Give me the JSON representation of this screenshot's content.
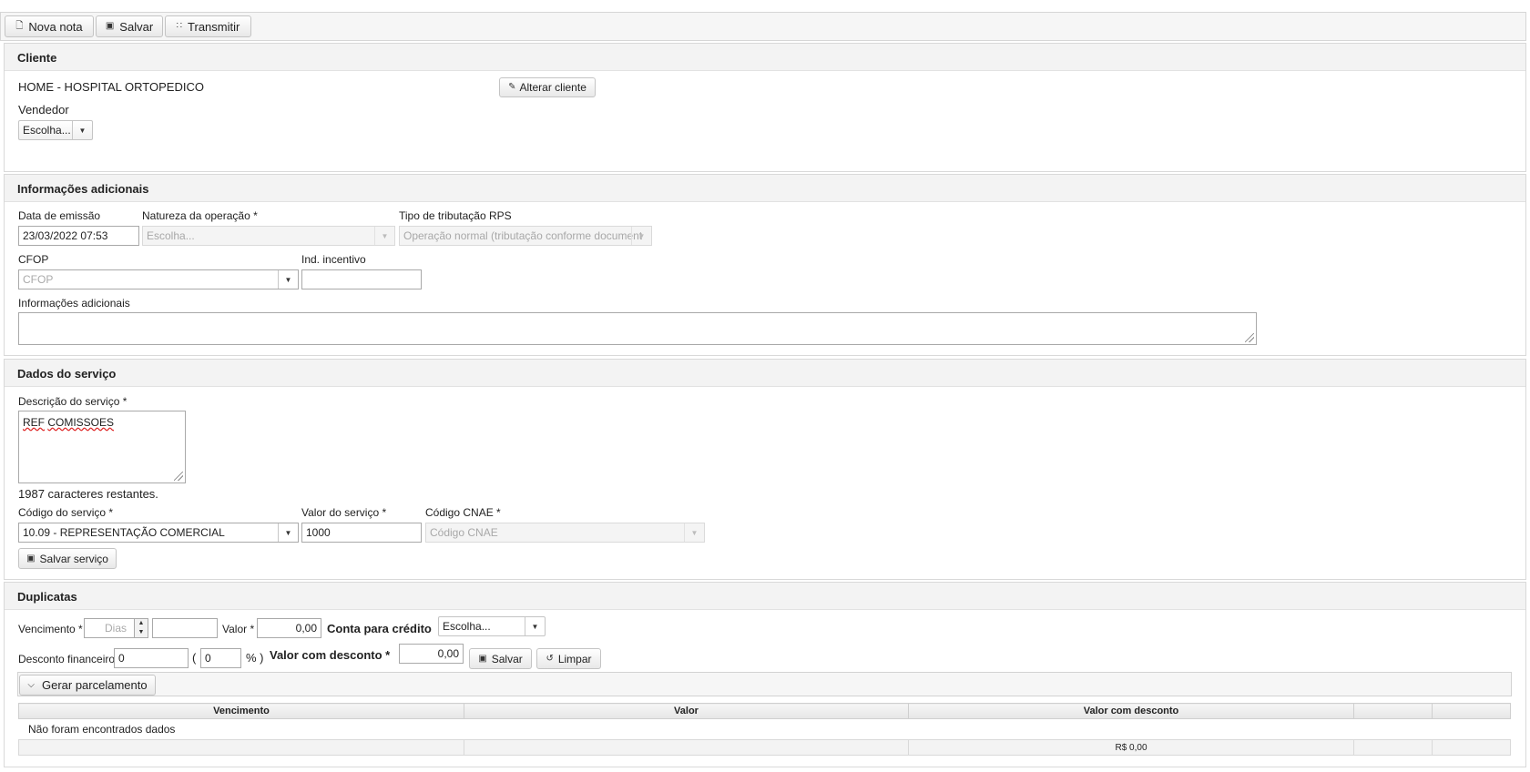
{
  "toolbar": {
    "new_label": "Nova nota",
    "save_label": "Salvar",
    "transmit_label": "Transmitir"
  },
  "cliente": {
    "title": "Cliente",
    "name": "HOME - HOSPITAL ORTOPEDICO",
    "change_button": "Alterar cliente",
    "vendedor_label": "Vendedor",
    "vendedor_value": "Escolha..."
  },
  "info": {
    "title": "Informações adicionais",
    "data_emissao_label": "Data de emissão",
    "data_emissao_value": "23/03/2022 07:53",
    "natureza_label": "Natureza da operação *",
    "natureza_placeholder": "Escolha...",
    "tributacao_label": "Tipo de tributação RPS",
    "tributacao_value": "Operação normal (tributação conforme document",
    "cfop_label": "CFOP",
    "cfop_placeholder": "CFOP",
    "ind_incentivo_label": "Ind. incentivo",
    "ind_incentivo_value": "",
    "info_label": "Informações adicionais",
    "info_value": ""
  },
  "servico": {
    "title": "Dados do serviço",
    "descricao_label": "Descrição do serviço *",
    "descricao_value_a": "REF",
    "descricao_value_b": "COMISSOES",
    "remaining": "1987 caracteres restantes.",
    "codigo_label": "Código do serviço *",
    "codigo_value": "10.09 - REPRESENTAÇÃO COMERCIAL",
    "valor_label": "Valor do serviço *",
    "valor_value": "1000",
    "cnae_label": "Código CNAE *",
    "cnae_placeholder": "Código CNAE",
    "save_button": "Salvar serviço"
  },
  "duplicatas": {
    "title": "Duplicatas",
    "vencimento_label": "Vencimento *",
    "dias_placeholder": "Dias",
    "date_value": "",
    "valor_label": "Valor *",
    "valor_value": "0,00",
    "conta_label": "Conta para crédito",
    "conta_value": "Escolha...",
    "desconto_label": "Desconto financeiro",
    "desconto_value": "0",
    "paren_open": "(",
    "percent_value": "0",
    "percent_close": "% )",
    "valor_desconto_label": "Valor com desconto *",
    "valor_desconto_value": "0,00",
    "save_button": "Salvar",
    "clear_button": "Limpar",
    "gerar_label": "Gerar parcelamento",
    "table": {
      "headers": [
        "Vencimento",
        "Valor",
        "Valor com desconto",
        "",
        ""
      ],
      "empty_message": "Não foram encontrados dados",
      "footer_total": "R$ 0,00"
    }
  }
}
